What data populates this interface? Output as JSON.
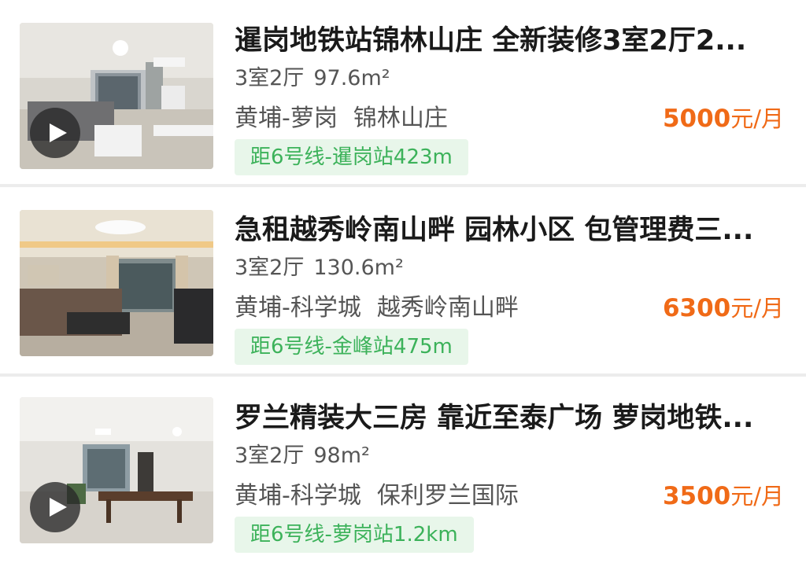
{
  "listings": [
    {
      "title": "暹岗地铁站锦林山庄 全新装修3室2厅2...",
      "rooms": "3室2厅",
      "area": "97.6m²",
      "district": "黄埔-萝岗",
      "community": "锦林山庄",
      "price": "5000",
      "price_unit": "元/月",
      "metro": "距6号线-暹岗站423m",
      "has_video": true
    },
    {
      "title": "急租越秀岭南山畔 园林小区 包管理费三...",
      "rooms": "3室2厅",
      "area": "130.6m²",
      "district": "黄埔-科学城",
      "community": "越秀岭南山畔",
      "price": "6300",
      "price_unit": "元/月",
      "metro": "距6号线-金峰站475m",
      "has_video": false
    },
    {
      "title": "罗兰精装大三房 靠近至泰广场 萝岗地铁...",
      "rooms": "3室2厅",
      "area": "98m²",
      "district": "黄埔-科学城",
      "community": "保利罗兰国际",
      "price": "3500",
      "price_unit": "元/月",
      "metro": "距6号线-萝岗站1.2km",
      "has_video": true
    }
  ],
  "colors": {
    "price": "#f06a17",
    "tag_text": "#3cb25a",
    "tag_bg": "#e8f6ea",
    "divider": "#ececec"
  },
  "icons": {
    "video": "play-icon"
  }
}
